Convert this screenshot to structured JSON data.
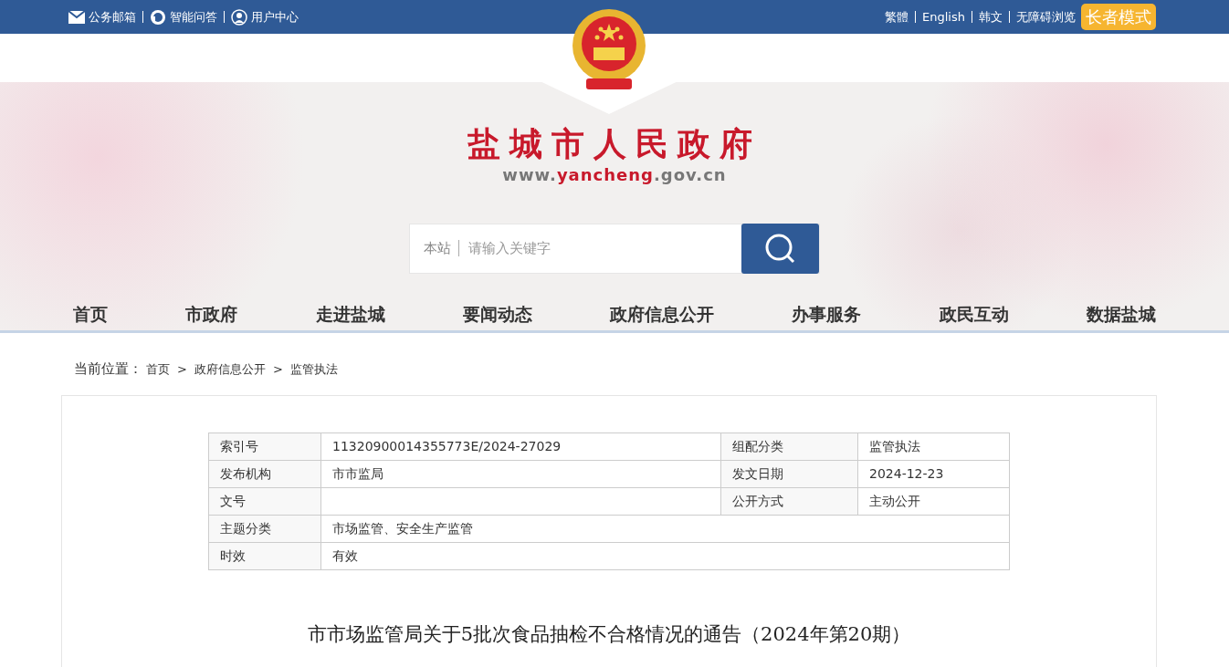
{
  "top_bar": {
    "left_links": [
      {
        "kind": "mail",
        "label": "公务邮箱"
      },
      {
        "kind": "chat",
        "label": "智能问答"
      },
      {
        "kind": "user",
        "label": "用户中心"
      }
    ],
    "right_links": [
      "繁體",
      "English",
      "韩文",
      "无障碍浏览"
    ],
    "elder_mode": "长者模式"
  },
  "header": {
    "site_name": "盐城市人民政府",
    "url_parts": [
      {
        "text": "www.",
        "highlight": false
      },
      {
        "text": "yancheng",
        "highlight": true
      },
      {
        "text": ".gov.cn",
        "highlight": false
      }
    ]
  },
  "search": {
    "scope": "本站",
    "placeholder": "请输入关键字"
  },
  "nav": [
    "首页",
    "市政府",
    "走进盐城",
    "要闻动态",
    "政府信息公开",
    "办事服务",
    "政民互动",
    "数据盐城"
  ],
  "breadcrumb": {
    "label": "当前位置：",
    "separator": ">",
    "items": [
      "首页",
      "政府信息公开",
      "监管执法"
    ]
  },
  "info_table": [
    [
      {
        "label": "索引号",
        "value": "11320900014355773E/2024-27029"
      },
      {
        "label": "组配分类",
        "value": "监管执法"
      }
    ],
    [
      {
        "label": "发布机构",
        "value": "市市监局"
      },
      {
        "label": "发文日期",
        "value": "2024-12-23"
      }
    ],
    [
      {
        "label": "文号"
      },
      {
        "label": "公开方式",
        "value": "主动公开"
      }
    ],
    [
      {
        "label": "主题分类",
        "value": "市场监管、安全生产监管"
      }
    ],
    [
      {
        "label": "时效",
        "value": "有效"
      }
    ]
  ],
  "article_title": "市市场监管局关于5批次食品抽检不合格情况的通告（2024年第20期）"
}
